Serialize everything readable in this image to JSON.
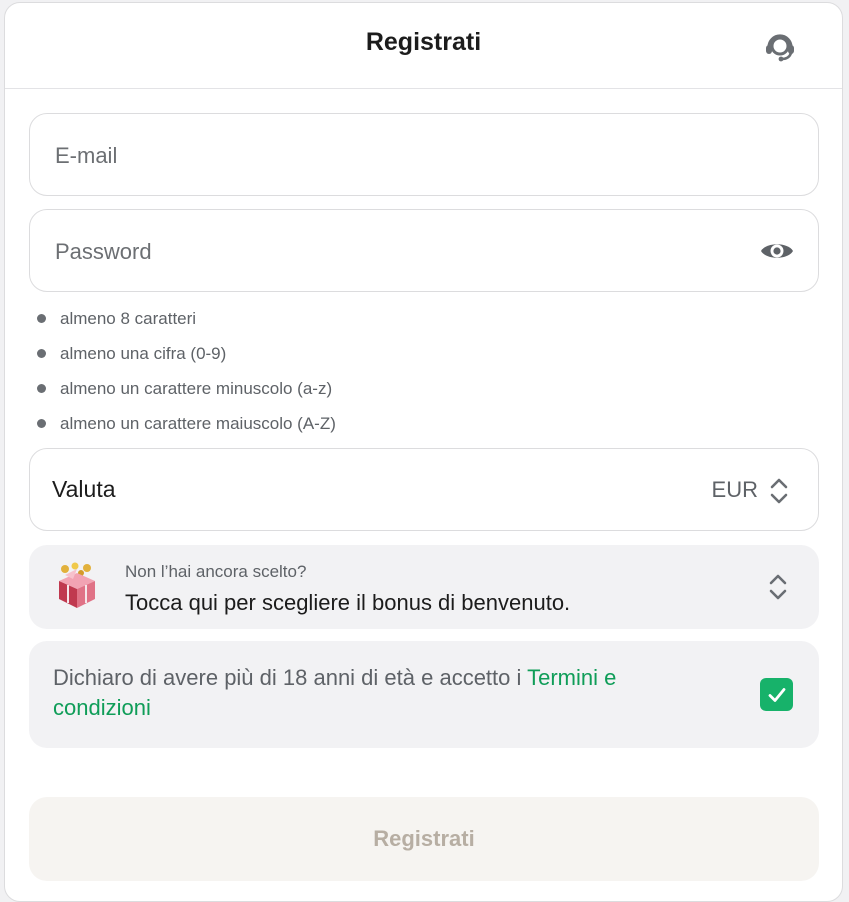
{
  "header": {
    "title": "Registrati",
    "support_icon": "headset-icon"
  },
  "form": {
    "email": {
      "placeholder": "E-mail",
      "value": ""
    },
    "password": {
      "placeholder": "Password",
      "value": "",
      "toggle_icon": "eye-icon"
    },
    "password_rules": [
      "almeno 8 caratteri",
      "almeno una cifra (0-9)",
      "almeno un carattere minuscolo (a-z)",
      "almeno un carattere maiuscolo (A-Z)"
    ],
    "currency": {
      "label": "Valuta",
      "value": "EUR",
      "icon": "sort-icon"
    },
    "bonus": {
      "hint": "Non l’hai ancora scelto?",
      "cta": "Tocca qui per scegliere il bonus di benvenuto.",
      "icon": "gift-icon"
    },
    "terms": {
      "text": "Dichiaro di avere più di 18 anni di età e accetto i ",
      "link": "Termini e condizioni",
      "checked": true
    },
    "submit_label": "Registrati"
  },
  "colors": {
    "accent_green": "#17b26a",
    "link_green": "#0f9d58",
    "disabled_text": "#b7aea3"
  }
}
